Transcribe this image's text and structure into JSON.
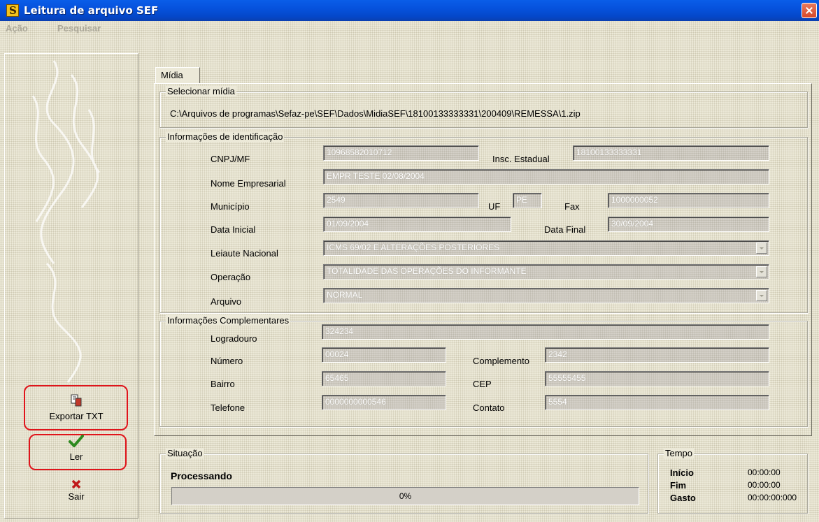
{
  "window": {
    "title": "Leitura de arquivo SEF"
  },
  "menu": [
    "Ação",
    "Pesquisar"
  ],
  "sidebar": {
    "export_label": "Exportar TXT",
    "read_label": "Ler",
    "exit_label": "Sair"
  },
  "tab": {
    "label": "Mídia"
  },
  "selecionar": {
    "legend": "Selecionar mídia",
    "path": "C:\\Arquivos de programas\\Sefaz-pe\\SEF\\Dados\\MidiaSEF\\18100133333331\\200409\\REMESSA\\1.zip"
  },
  "identificacao": {
    "legend": "Informações de identificação",
    "cnpj_label": "CNPJ/MF",
    "cnpj": "10968582010712",
    "insc_label": "Insc. Estadual",
    "insc": "18100133333331",
    "nome_label": "Nome Empresarial",
    "nome": "EMPR TESTE 02/08/2004",
    "municipio_label": "Município",
    "municipio": "2549",
    "uf_label": "UF",
    "uf": "PE",
    "fax_label": "Fax",
    "fax": "1000000052",
    "data_inicial_label": "Data Inicial",
    "data_inicial": "01/09/2004",
    "data_final_label": "Data Final",
    "data_final": "30/09/2004",
    "leiaute_label": "Leiaute Nacional",
    "leiaute": "ICMS 69/02 E ALTERAÇÕES POSTERIORES",
    "operacao_label": "Operação",
    "operacao": "TOTALIDADE DAS OPERAÇÕES DO INFORMANTE",
    "arquivo_label": "Arquivo",
    "arquivo": "NORMAL"
  },
  "complementares": {
    "legend": "Informações Complementares",
    "logradouro_label": "Logradouro",
    "logradouro": "324234",
    "numero_label": "Número",
    "numero": "00024",
    "complemento_label": "Complemento",
    "complemento": "2342",
    "bairro_label": "Bairro",
    "bairro": "65465",
    "cep_label": "CEP",
    "cep": "55555455",
    "telefone_label": "Telefone",
    "telefone": "0000000000546",
    "contato_label": "Contato",
    "contato": "5554"
  },
  "situacao": {
    "legend": "Situação",
    "status": "Processando",
    "progress_text": "0%",
    "progress_fraction": 0
  },
  "tempo": {
    "legend": "Tempo",
    "inicio_label": "Início",
    "inicio": "00:00:00",
    "fim_label": "Fim",
    "fim": "00:00:00",
    "gasto_label": "Gasto",
    "gasto": "00:00:00:000"
  },
  "colors": {
    "title_bar": "#0652dd",
    "highlight": "#e0141b",
    "panel_bg": "#ece9d8"
  }
}
